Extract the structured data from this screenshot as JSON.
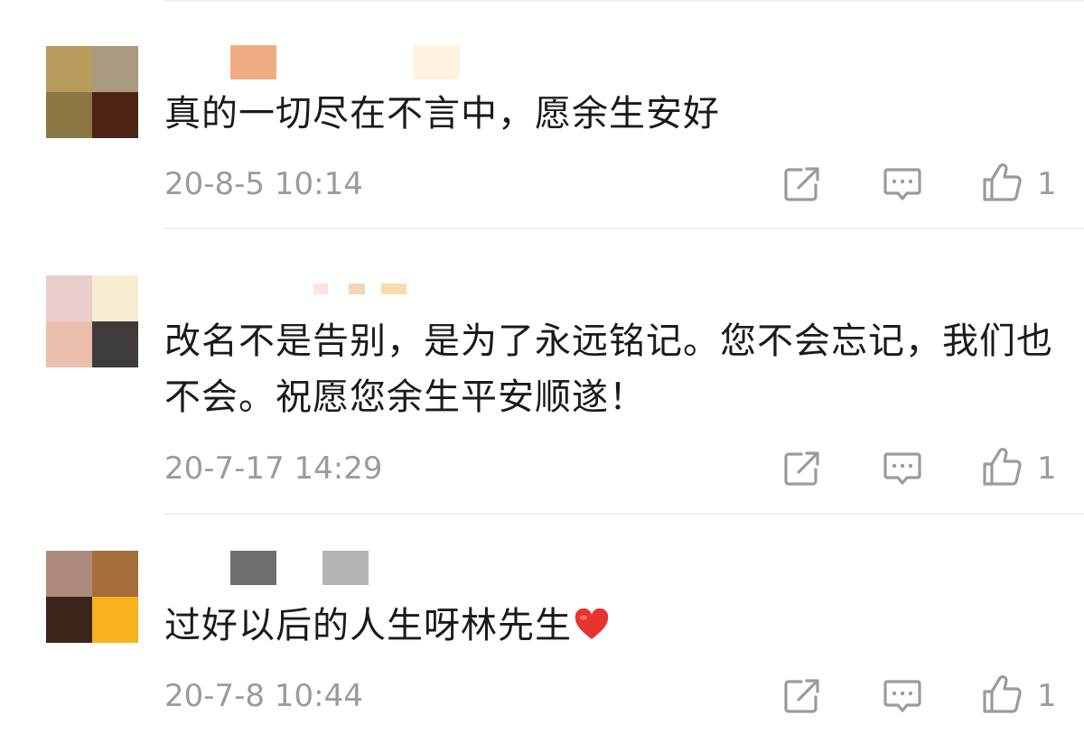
{
  "comments": [
    {
      "text": "真的一切尽在不言中，愿余生安好",
      "timestamp": "20-8-5 10:14",
      "like_count": "1",
      "avatar_colors": [
        "#b79a5c",
        "#a8997f",
        "#8a7743",
        "#4e2416"
      ],
      "name_colors": [
        "#f0ad82",
        "#fdf3de"
      ]
    },
    {
      "text": "改名不是告别，是为了永远铭记。您不会忘记，我们也不会。祝愿您余生平安顺遂！",
      "timestamp": "20-7-17 14:29",
      "like_count": "1",
      "avatar_colors": [
        "#e9cdcd",
        "#f6ecd1",
        "#ecbeae",
        "#3f3b3a"
      ],
      "name_colors": [
        "#fbe4dc",
        "#f2d6b8"
      ]
    },
    {
      "text": "过好以后的人生呀林先生",
      "timestamp": "20-7-8 10:44",
      "like_count": "1",
      "avatar_colors": [
        "#ad8a7b",
        "#a46f3d",
        "#3b2418",
        "#f7b21d"
      ],
      "name_colors": [
        "#6e6e6e",
        "#b4b4b4"
      ]
    }
  ],
  "icons": {
    "share": "share-icon",
    "reply": "comment-icon",
    "like": "thumbs-up-icon",
    "heart": "red-heart-emoji"
  },
  "colors": {
    "text": "#1a1a1a",
    "meta": "#9b9b9b",
    "heart": "#e8322f"
  }
}
